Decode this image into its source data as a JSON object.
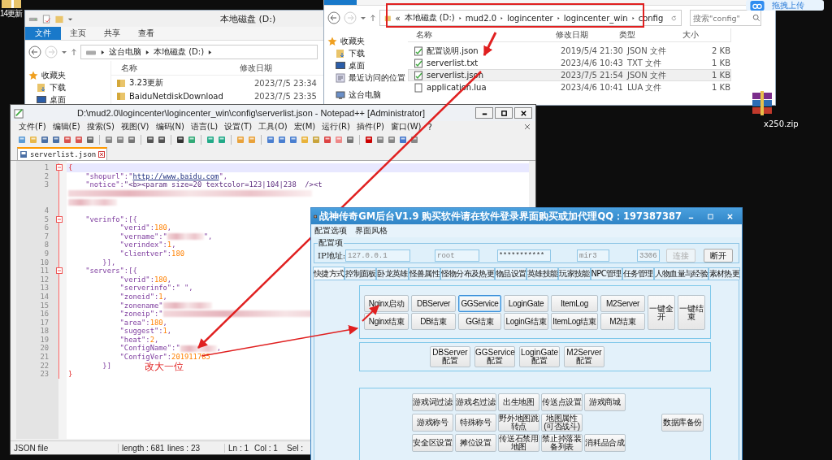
{
  "desktop": {
    "icon_label": "14更新",
    "zip_label": "x250.zip",
    "upload_button": "拖拽上传"
  },
  "explorer_back": {
    "title": "本地磁盘 (D:)",
    "ribbon_tabs": [
      {
        "label": "文件",
        "selected": true
      },
      {
        "label": "主页",
        "selected": false
      },
      {
        "label": "共享",
        "selected": false
      },
      {
        "label": "查看",
        "selected": false
      }
    ],
    "path": [
      "这台电脑",
      "本地磁盘 (D:)"
    ],
    "nav": [
      {
        "label": "收藏夹",
        "kind": "favorites"
      },
      {
        "label": "下载",
        "kind": "download"
      },
      {
        "label": "桌面",
        "kind": "desktop"
      }
    ],
    "columns": [
      "名称",
      "修改日期"
    ],
    "rows": [
      {
        "name": "3.23更新",
        "modified": "2023/7/5 23:34",
        "kind": "folder"
      },
      {
        "name": "BaiduNetdiskDownload",
        "modified": "2023/7/5 23:35",
        "kind": "folder"
      }
    ]
  },
  "explorer_front": {
    "path_prefix": "«",
    "path": [
      "本地磁盘 (D:)",
      "mud2.0",
      "logincenter",
      "logincenter_win",
      "config"
    ],
    "search": {
      "placeholder": "搜索\"config\""
    },
    "nav": [
      {
        "label": "收藏夹",
        "kind": "favorites"
      },
      {
        "label": "下载",
        "kind": "download"
      },
      {
        "label": "桌面",
        "kind": "desktop"
      },
      {
        "label": "最近访问的位置",
        "kind": "recent"
      },
      {
        "label": "这台电脑",
        "kind": "computer"
      }
    ],
    "columns": [
      "名称",
      "修改日期",
      "类型",
      "大小"
    ],
    "rows": [
      {
        "name": "配置说明.json",
        "modified": "2019/5/4 21:30",
        "type": "JSON 文件",
        "size": "2 KB",
        "kind": "text",
        "selected": false
      },
      {
        "name": "serverlist.txt",
        "modified": "2023/4/6 10:43",
        "type": "TXT 文件",
        "size": "1 KB",
        "kind": "text",
        "selected": false
      },
      {
        "name": "serverlist.json",
        "modified": "2023/7/5 21:54",
        "type": "JSON 文件",
        "size": "1 KB",
        "kind": "text",
        "selected": true
      },
      {
        "name": "application.lua",
        "modified": "2023/4/6 10:41",
        "type": "LUA 文件",
        "size": "1 KB",
        "kind": "blank",
        "selected": false
      }
    ]
  },
  "notepad": {
    "title": "D:\\mud2.0\\logincenter\\logincenter_win\\config\\serverlist.json - Notepad++ [Administrator]",
    "menu": [
      "文件(F)",
      "编辑(E)",
      "搜索(S)",
      "视图(V)",
      "编码(N)",
      "语言(L)",
      "设置(T)",
      "工具(O)",
      "宏(M)",
      "运行(R)",
      "插件(P)",
      "窗口(W)",
      "?"
    ],
    "tab": "serverlist.json",
    "lines": [
      {
        "number": "1",
        "fold": true,
        "current": true,
        "tokens": [
          {
            "kind": "brace",
            "text": "{"
          }
        ]
      },
      {
        "number": "2",
        "fold": false,
        "current": false,
        "tokens": [
          {
            "kind": "key",
            "text": "    \"shopurl\""
          },
          {
            "kind": "punct",
            "text": ":\""
          },
          {
            "kind": "link",
            "text": "http://www.baidu.com"
          },
          {
            "kind": "punct",
            "text": "\","
          }
        ]
      },
      {
        "number": "3",
        "fold": false,
        "current": false,
        "tokens": [
          {
            "kind": "key",
            "text": "    \"notice\""
          },
          {
            "kind": "punct",
            "text": ":"
          },
          {
            "kind": "str",
            "text": "\"<b><param size=20 textcolor=123|104|238  /><t"
          }
        ]
      },
      {
        "fold": false,
        "current": false,
        "tokens": [
          {
            "kind": "redacted_long"
          }
        ]
      },
      {
        "fold": false,
        "current": false,
        "tokens": [
          {
            "kind": "redacted_mid"
          }
        ]
      },
      {
        "number": "4",
        "fold": false,
        "current": false
      },
      {
        "number": "5",
        "fold": true,
        "current": false,
        "tokens": [
          {
            "kind": "key",
            "text": "    \"verinfo\""
          },
          {
            "kind": "punct",
            "text": ":[{"
          }
        ]
      },
      {
        "number": "6",
        "fold": false,
        "current": false,
        "tokens": [
          {
            "kind": "key",
            "text": "            \"verid\""
          },
          {
            "kind": "punct",
            "text": ":"
          },
          {
            "kind": "num",
            "text": "180"
          },
          {
            "kind": "punct",
            "text": ","
          }
        ]
      },
      {
        "number": "7",
        "fold": false,
        "current": false,
        "tokens": [
          {
            "kind": "key",
            "text": "            \"vername\""
          },
          {
            "kind": "punct",
            "text": ":\""
          },
          {
            "kind": "redacted_short"
          },
          {
            "kind": "punct",
            "text": "\","
          }
        ]
      },
      {
        "number": "8",
        "fold": false,
        "current": false,
        "tokens": [
          {
            "kind": "key",
            "text": "            \"verindex\""
          },
          {
            "kind": "punct",
            "text": ":"
          },
          {
            "kind": "num",
            "text": "1"
          },
          {
            "kind": "punct",
            "text": ","
          }
        ]
      },
      {
        "number": "9",
        "fold": false,
        "current": false,
        "tokens": [
          {
            "kind": "key",
            "text": "            \"clientver\""
          },
          {
            "kind": "punct",
            "text": ":"
          },
          {
            "kind": "num",
            "text": "180"
          }
        ]
      },
      {
        "number": "10",
        "fold": false,
        "current": false,
        "tokens": [
          {
            "kind": "punct",
            "text": "        }],"
          }
        ]
      },
      {
        "number": "11",
        "fold": true,
        "current": false,
        "tokens": [
          {
            "kind": "key",
            "text": "    \"servers\""
          },
          {
            "kind": "punct",
            "text": ":[{"
          }
        ]
      },
      {
        "number": "12",
        "fold": false,
        "current": false,
        "tokens": [
          {
            "kind": "key",
            "text": "            \"verid\""
          },
          {
            "kind": "punct",
            "text": ":"
          },
          {
            "kind": "num",
            "text": "180"
          },
          {
            "kind": "punct",
            "text": ","
          }
        ]
      },
      {
        "number": "13",
        "fold": false,
        "current": false,
        "tokens": [
          {
            "kind": "key",
            "text": "            \"serverinfo\""
          },
          {
            "kind": "punct",
            "text": ":\" \","
          }
        ]
      },
      {
        "number": "14",
        "fold": false,
        "current": false,
        "tokens": [
          {
            "kind": "key",
            "text": "            \"zoneid\""
          },
          {
            "kind": "punct",
            "text": ":"
          },
          {
            "kind": "num",
            "text": "1"
          },
          {
            "kind": "punct",
            "text": ","
          }
        ]
      },
      {
        "number": "15",
        "fold": false,
        "current": false,
        "tokens": [
          {
            "kind": "key",
            "text": "            \"zonename\""
          },
          {
            "kind": "redacted_mid"
          }
        ]
      },
      {
        "number": "16",
        "fold": false,
        "current": false,
        "tokens": [
          {
            "kind": "key",
            "text": "            \"zoneip\""
          },
          {
            "kind": "punct",
            "text": ":\""
          },
          {
            "kind": "redacted_long"
          }
        ]
      },
      {
        "number": "17",
        "fold": false,
        "current": false,
        "tokens": [
          {
            "kind": "key",
            "text": "            \"area\""
          },
          {
            "kind": "punct",
            "text": ":"
          },
          {
            "kind": "num",
            "text": "180"
          },
          {
            "kind": "punct",
            "text": ","
          }
        ]
      },
      {
        "number": "18",
        "fold": false,
        "current": false,
        "tokens": [
          {
            "kind": "key",
            "text": "            \"suggest\""
          },
          {
            "kind": "punct",
            "text": ":"
          },
          {
            "kind": "num",
            "text": "1"
          },
          {
            "kind": "punct",
            "text": ","
          }
        ]
      },
      {
        "number": "19",
        "fold": false,
        "current": false,
        "tokens": [
          {
            "kind": "key",
            "text": "            \"heat\""
          },
          {
            "kind": "punct",
            "text": ":"
          },
          {
            "kind": "num",
            "text": "2"
          },
          {
            "kind": "punct",
            "text": ","
          }
        ]
      },
      {
        "number": "20",
        "fold": false,
        "current": false,
        "tokens": [
          {
            "kind": "key",
            "text": "            \"ConfigName\""
          },
          {
            "kind": "punct",
            "text": ":\""
          },
          {
            "kind": "redacted_short"
          },
          {
            "kind": "punct",
            "text": ","
          }
        ]
      },
      {
        "number": "21",
        "fold": false,
        "current": false,
        "tokens": [
          {
            "kind": "key",
            "text": "            \"ConfigVer\""
          },
          {
            "kind": "punct",
            "text": ":"
          },
          {
            "kind": "num",
            "text": "201911785"
          }
        ]
      },
      {
        "number": "22",
        "fold": false,
        "current": false,
        "tokens": [
          {
            "kind": "punct",
            "text": "        }]"
          }
        ]
      },
      {
        "number": "23",
        "fold": false,
        "current": false,
        "tokens": [
          {
            "kind": "brace",
            "text": "}"
          }
        ]
      }
    ],
    "status": [
      "JSON file",
      "length : 681",
      "lines : 23",
      "Ln : 1",
      "Col : 1",
      "Sel :"
    ]
  },
  "annotation": "改大一位",
  "gm": {
    "title": "战神传奇GM后台V1.9   购买软件请在软件登录界面购买或加代理QQ：197387387",
    "menu": [
      "配置选项",
      "界面风格"
    ],
    "group": "配置项",
    "ip_label": "IP地址:",
    "fields": [
      "127.0.0.1",
      "root",
      "***********",
      "mir3",
      "3306"
    ],
    "connection_buttons": [
      {
        "label": "连接",
        "disabled": true
      },
      {
        "label": "断开",
        "disabled": false
      }
    ],
    "tabs": [
      {
        "label": "快捷方式",
        "selected": true
      },
      {
        "label": "控制面板",
        "selected": false
      },
      {
        "label": "卧龙英雄",
        "selected": false
      },
      {
        "label": "怪兽属性",
        "selected": false
      },
      {
        "label": "怪物分布及热更",
        "selected": false
      },
      {
        "label": "物品设置",
        "selected": false
      },
      {
        "label": "英雄技能",
        "selected": false
      },
      {
        "label": "玩家技能",
        "selected": false
      },
      {
        "label": "NPC管理",
        "selected": false
      },
      {
        "label": "任务管理",
        "selected": false
      },
      {
        "label": "人物血量与经验",
        "selected": false
      },
      {
        "label": "素材热更",
        "selected": false
      }
    ],
    "quick_columns": [
      {
        "buttons": [
          {
            "label": "Nginx启动",
            "focused": false
          },
          {
            "label": "Nginx结束",
            "focused": false
          }
        ]
      },
      {
        "buttons": [
          {
            "label": "DBServer",
            "focused": false
          },
          {
            "label": "DB结束",
            "focused": false
          }
        ]
      },
      {
        "buttons": [
          {
            "label": "GGService",
            "focused": true
          },
          {
            "label": "GG结束",
            "focused": false
          }
        ]
      },
      {
        "buttons": [
          {
            "label": "LoginGate",
            "focused": false
          },
          {
            "label": "LoginG结束",
            "focused": false
          }
        ]
      },
      {
        "buttons": [
          {
            "label": "ItemLog",
            "focused": false
          },
          {
            "label": "ItemLog结束",
            "focused": false
          }
        ]
      },
      {
        "buttons": [
          {
            "label": "M2Server",
            "focused": false
          },
          {
            "label": "M2结束",
            "focused": false
          }
        ]
      }
    ],
    "big_buttons": [
      "一键全开",
      "一键结束"
    ],
    "config_buttons": [
      "DBServer 配置",
      "GGService 配置",
      "LoginGate 配置",
      "M2Server 配置"
    ],
    "tool_rows": [
      [
        "游戏词过滤",
        "游戏名过滤",
        "出生地图",
        "传送点设置",
        "游戏商城"
      ],
      [
        "游戏称号",
        "特殊称号",
        "野外地图跳转点",
        "地图属性(可否战斗)"
      ],
      [
        "安全区设置",
        "摊位设置",
        "传送石禁用地图",
        "禁止掉落装备列表",
        "消耗品合成"
      ]
    ],
    "backup_button": "数据库备份"
  }
}
